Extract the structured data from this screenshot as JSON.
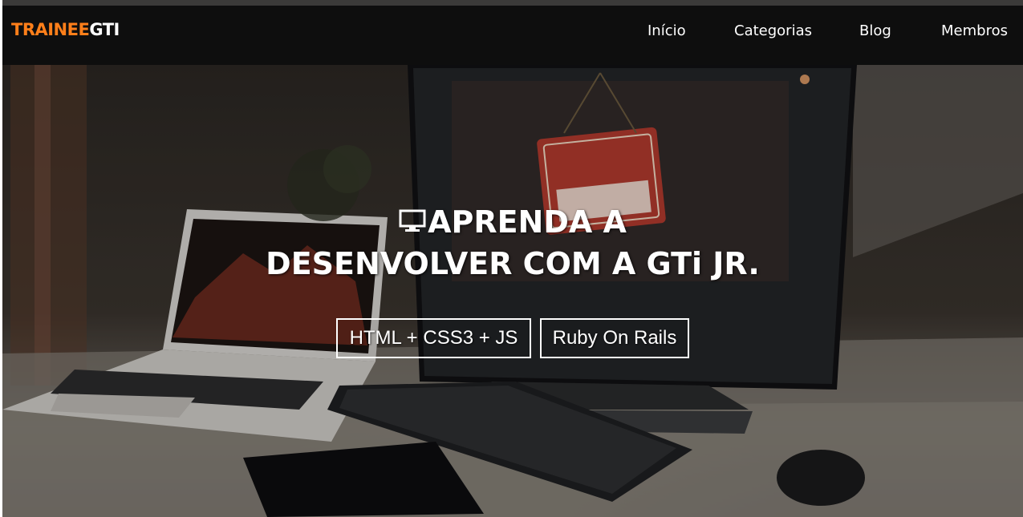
{
  "brand": {
    "logo_primary": "TRAINEE",
    "logo_secondary": "GTI",
    "accent_color": "#ff7f1a"
  },
  "nav": {
    "items": [
      {
        "label": "Início"
      },
      {
        "label": "Categorias"
      },
      {
        "label": "Blog"
      },
      {
        "label": "Membros"
      }
    ]
  },
  "hero": {
    "icon": "monitor-icon",
    "title_line1": "APRENDA A",
    "title_line2": "DESENVOLVER COM A GTi JR.",
    "buttons": [
      {
        "label": "HTML + CSS3 + JS"
      },
      {
        "label": "Ruby On Rails"
      }
    ]
  }
}
